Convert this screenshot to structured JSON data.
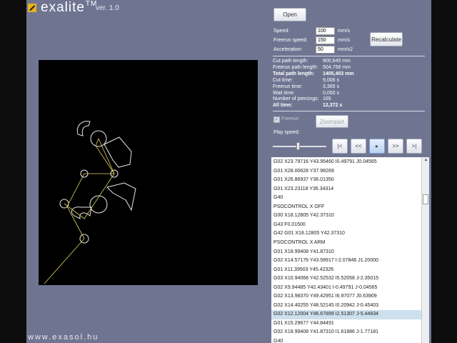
{
  "header": {
    "brand": "exalite",
    "trademark": "TM",
    "version": "ver. 1.0"
  },
  "footer": {
    "url": "www.exasol.hu"
  },
  "toolbar": {
    "open_label": "Open",
    "recalculate_label": "Recalculate",
    "zoompart_label": "Zoompart"
  },
  "params": {
    "speed": {
      "label": "Speed:",
      "value": "100",
      "unit": "mm/s"
    },
    "freerun_speed": {
      "label": "Freerun speed:",
      "value": "150",
      "unit": "mm/s"
    },
    "acceleration": {
      "label": "Acceleration:",
      "value": "50",
      "unit": "mm/s2"
    }
  },
  "stats": [
    {
      "label": "Cut path length:",
      "value": "900,645 mm",
      "bold": false
    },
    {
      "label": "Freerun path length:",
      "value": "504,758 mm",
      "bold": false
    },
    {
      "label": "Total path length:",
      "value": "1405,403 mm",
      "bold": true
    },
    {
      "label": "Cut time:",
      "value": "9,006 s",
      "bold": false
    },
    {
      "label": "Freerun time:",
      "value": "3,365 s",
      "bold": false
    },
    {
      "label": "Wait time:",
      "value": "0,000 s",
      "bold": false
    },
    {
      "label": "Number of piercings:",
      "value": "165",
      "bold": false
    },
    {
      "label": "All time:",
      "value": "12,372 s",
      "bold": true
    }
  ],
  "freerun": {
    "label": "Freerun",
    "checked": true,
    "check_glyph": "✓"
  },
  "play": {
    "speed_label": "Play speed:",
    "slider_level": 0.47,
    "buttons": [
      {
        "name": "first-button",
        "label": "|<"
      },
      {
        "name": "rewind-button",
        "label": "<<"
      },
      {
        "name": "step-button",
        "label": "▸"
      },
      {
        "name": "forward-button",
        "label": ">>"
      },
      {
        "name": "last-button",
        "label": ">|"
      }
    ]
  },
  "gcode": {
    "selected_index": 17,
    "lines": [
      "G02 X23.79716 Y43.95460 I0.49791 J0.04565",
      "G01 X28.00628 Y37.98269",
      "G01 X26.86937 Y36.01350",
      "G01 X23.23118 Y36.34314",
      "G40",
      "PSOCONTROL X OFF",
      "G00 X18.12805 Y42.37310",
      "G43 F0.01500",
      "G42 G01 X18.12805 Y42.37310",
      "PSOCONTROL X ARM",
      "G01 X18.99408 Y41.87310",
      "G02 X14.57176 Y43.58917 I-2.07846 J1.20000",
      "G01 X11.39503 Y45.42326",
      "G03 X10.94068 Y42.52532 I5.52058 J-2.35015",
      "G02 X9.94485 Y42.43401 I-0.49791 J-0.04565",
      "G02 X13.98370 Y49.42951 I6.97077 J0.63909",
      "G02 X14.40255 Y48.52145 I0.20942 J-0.45403",
      "G02 X12.12004 Y46.67899 I2.51307 J-5.44834",
      "G01 X15.29677 Y44.84491",
      "G02 X18.99408 Y41.87310 I1.61886 J-1.77181",
      "G40"
    ]
  }
}
